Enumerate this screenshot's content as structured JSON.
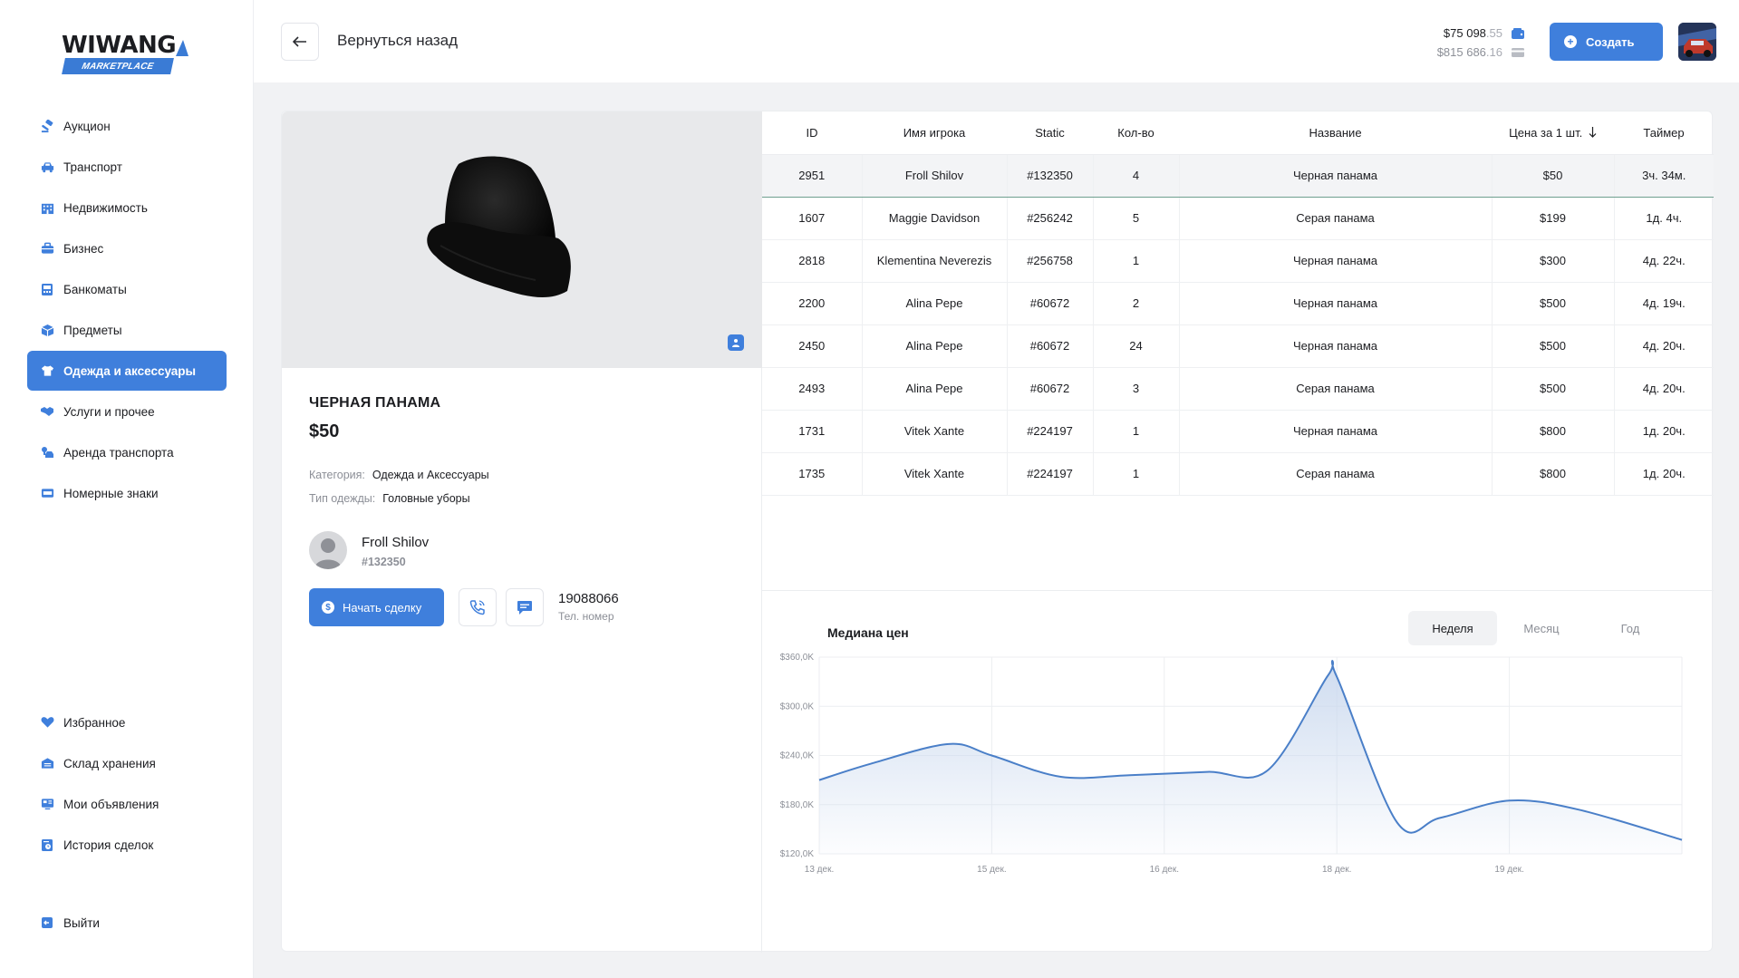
{
  "app": {
    "logo_word": "WIWANG",
    "logo_sub": "MARKETPLACE",
    "accent_color": "#3f7fdc"
  },
  "sidebar": {
    "items": [
      {
        "label": "Аукцион",
        "icon": "gavel-icon"
      },
      {
        "label": "Транспорт",
        "icon": "car-icon"
      },
      {
        "label": "Недвижимость",
        "icon": "building-icon"
      },
      {
        "label": "Бизнес",
        "icon": "briefcase-icon"
      },
      {
        "label": "Банкоматы",
        "icon": "atm-icon"
      },
      {
        "label": "Предметы",
        "icon": "box-icon"
      },
      {
        "label": "Одежда и аксессуары",
        "icon": "clothes-icon",
        "active": true
      },
      {
        "label": "Услуги и прочее",
        "icon": "handshake-icon"
      },
      {
        "label": "Аренда транспорта",
        "icon": "car-key-icon"
      },
      {
        "label": "Номерные знаки",
        "icon": "plate-icon"
      }
    ],
    "bottom_items": [
      {
        "label": "Избранное",
        "icon": "heart-icon"
      },
      {
        "label": "Склад хранения",
        "icon": "warehouse-icon"
      },
      {
        "label": "Мои объявления",
        "icon": "listings-icon"
      },
      {
        "label": "История сделок",
        "icon": "history-icon"
      }
    ],
    "exit_label": "Выйти"
  },
  "header": {
    "back_label": "Вернуться назад",
    "balance_main": "$75 098",
    "balance_main_dec": ".55",
    "balance_bank": "$815 686",
    "balance_bank_dec": ".16",
    "create_label": "Создать"
  },
  "product": {
    "title": "ЧЕРНАЯ ПАНАМА",
    "price": "$50",
    "category_key": "Категория:",
    "category_val": "Одежда и Аксессуары",
    "type_key": "Тип одежды:",
    "type_val": "Головные уборы",
    "seller_name": "Froll Shilov",
    "seller_id": "#132350",
    "deal_label": "Начать сделку",
    "phone": "19088066",
    "phone_label": "Тел. номер"
  },
  "table": {
    "headers": [
      "ID",
      "Имя игрока",
      "Static",
      "Кол-во",
      "Название",
      "Цена за 1 шт.",
      "Таймер"
    ],
    "rows": [
      [
        "2951",
        "Froll Shilov",
        "#132350",
        "4",
        "Черная панама",
        "$50",
        "3ч. 34м."
      ],
      [
        "1607",
        "Maggie Davidson",
        "#256242",
        "5",
        "Серая панама",
        "$199",
        "1д. 4ч."
      ],
      [
        "2818",
        "Klementina Neverezis",
        "#256758",
        "1",
        "Черная панама",
        "$300",
        "4д. 22ч."
      ],
      [
        "2200",
        "Alina Pepe",
        "#60672",
        "2",
        "Черная панама",
        "$500",
        "4д. 19ч."
      ],
      [
        "2450",
        "Alina Pepe",
        "#60672",
        "24",
        "Черная панама",
        "$500",
        "4д. 20ч."
      ],
      [
        "2493",
        "Alina Pepe",
        "#60672",
        "3",
        "Серая панама",
        "$500",
        "4д. 20ч."
      ],
      [
        "1731",
        "Vitek Xante",
        "#224197",
        "1",
        "Черная панама",
        "$800",
        "1д. 20ч."
      ],
      [
        "1735",
        "Vitek Xante",
        "#224197",
        "1",
        "Серая панама",
        "$800",
        "1д. 20ч."
      ]
    ]
  },
  "chart_tabs": [
    "Неделя",
    "Месяц",
    "Год"
  ],
  "chart_data": {
    "type": "area",
    "title": "Медиана цен",
    "x_labels": [
      "13 дек.",
      "15 дек.",
      "16 дек.",
      "18 дек.",
      "19 дек."
    ],
    "y_ticks": [
      "$360,0K",
      "$300,0K",
      "$240,0K",
      "$180,0K",
      "$120,0K"
    ],
    "ylim": [
      120000,
      360000
    ],
    "x": [
      0,
      0.3,
      0.75,
      1.0,
      1.4,
      1.8,
      2.25,
      2.6,
      2.95,
      3.0,
      3.35,
      3.6,
      4.0,
      4.4,
      5.0
    ],
    "values": [
      210000,
      230000,
      254000,
      240000,
      214000,
      216000,
      220000,
      222000,
      338000,
      336000,
      158000,
      164000,
      185000,
      174000,
      137000
    ],
    "grid": true,
    "line_color": "#4a7fc8",
    "fill_color": "#c9d8ee"
  }
}
